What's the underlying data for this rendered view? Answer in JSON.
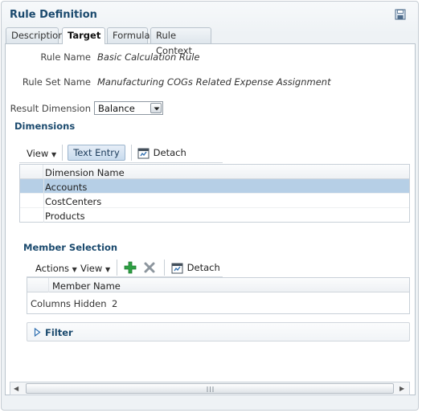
{
  "panel": {
    "title": "Rule Definition"
  },
  "tabs": [
    {
      "label": "Description"
    },
    {
      "label": "Target"
    },
    {
      "label": "Formula"
    },
    {
      "label": "Rule Context"
    }
  ],
  "rule": {
    "name_label": "Rule Name",
    "name_value": "Basic Calculation Rule",
    "set_label": "Rule Set Name",
    "set_value": "Manufacturing COGs Related Expense Assignment",
    "result_dim_label": "Result Dimension",
    "result_dim_value": "Balance"
  },
  "dimensions": {
    "heading": "Dimensions",
    "view_label": "View",
    "text_entry_label": "Text Entry",
    "detach_label": "Detach",
    "column_header": "Dimension Name",
    "rows": [
      "Accounts",
      "CostCenters",
      "Products"
    ]
  },
  "member_selection": {
    "heading": "Member Selection",
    "actions_label": "Actions",
    "view_label": "View",
    "detach_label": "Detach",
    "column_header": "Member Name",
    "columns_hidden_label": "Columns Hidden",
    "columns_hidden_value": "2"
  },
  "filter": {
    "label": "Filter"
  },
  "colors": {
    "heading": "#1b4a6e",
    "selected_row": "#b6cfe6",
    "add_icon": "#2ea043",
    "remove_icon": "#8d969e"
  }
}
